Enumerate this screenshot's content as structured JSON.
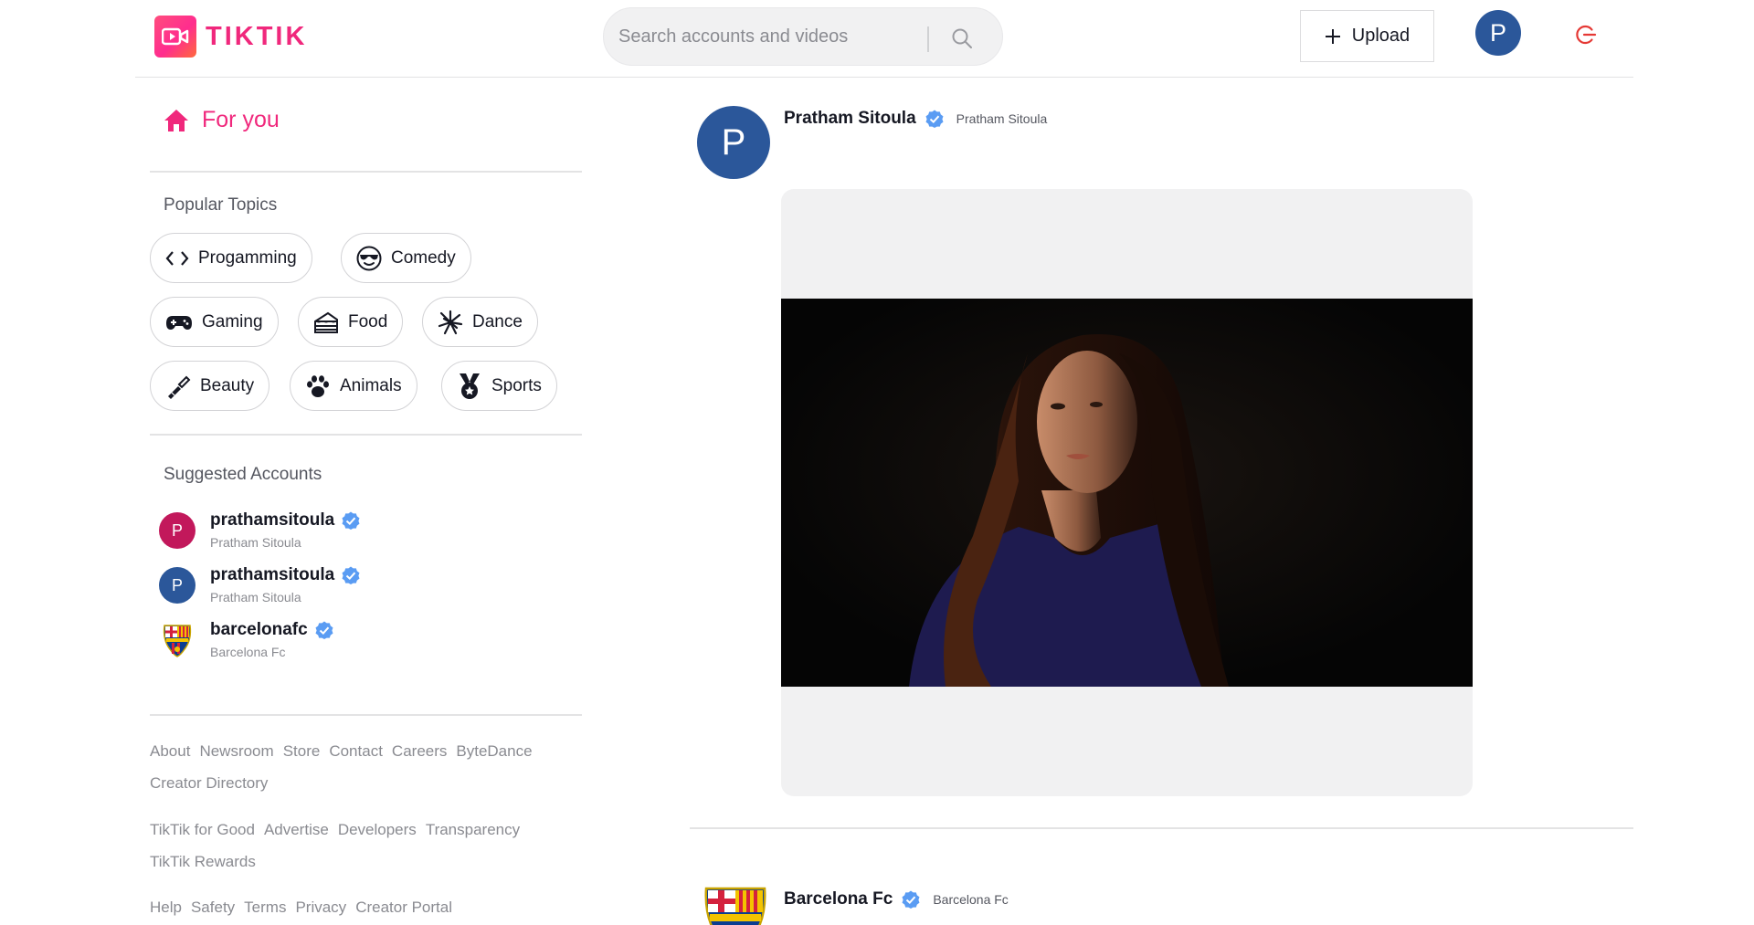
{
  "brand": {
    "name": "TIKTIK",
    "color": "#f0287c"
  },
  "search": {
    "placeholder": "Search accounts and videos"
  },
  "header": {
    "upload_label": "Upload",
    "avatar_letter": "P",
    "avatar_color": "#2b579a"
  },
  "sidebar": {
    "for_you": "For you",
    "popular_title": "Popular Topics",
    "topics": [
      {
        "label": "Progamming",
        "icon": "code-icon"
      },
      {
        "label": "Comedy",
        "icon": "sunglasses-face-icon"
      },
      {
        "label": "Gaming",
        "icon": "gamepad-icon"
      },
      {
        "label": "Food",
        "icon": "cake-icon"
      },
      {
        "label": "Dance",
        "icon": "dancer-icon"
      },
      {
        "label": "Beauty",
        "icon": "brush-icon"
      },
      {
        "label": "Animals",
        "icon": "paw-icon"
      },
      {
        "label": "Sports",
        "icon": "medal-icon"
      }
    ],
    "suggested_title": "Suggested Accounts",
    "suggested": [
      {
        "username": "prathamsitoula",
        "name": "Pratham Sitoula",
        "avatar": "P",
        "color": "#c2185b"
      },
      {
        "username": "prathamsitoula",
        "name": "Pratham Sitoula",
        "avatar": "P",
        "color": "#2b579a"
      },
      {
        "username": "barcelonafc",
        "name": "Barcelona Fc",
        "avatar": "crest"
      }
    ],
    "footer_groups": [
      [
        "About",
        "Newsroom",
        "Store",
        "Contact",
        "Careers",
        "ByteDance",
        "Creator Directory"
      ],
      [
        "TikTik for Good",
        "Advertise",
        "Developers",
        "Transparency",
        "TikTik Rewards"
      ],
      [
        "Help",
        "Safety",
        "Terms",
        "Privacy",
        "Creator Portal"
      ]
    ]
  },
  "feed": {
    "posts": [
      {
        "name": "Pratham Sitoula",
        "handle": "Pratham Sitoula",
        "avatar": "P"
      },
      {
        "name": "Barcelona Fc",
        "handle": "Barcelona Fc",
        "avatar": "crest"
      }
    ]
  },
  "colors": {
    "verified": "#5a9cf3",
    "logout": "#e53935",
    "accent": "#f0287c"
  }
}
